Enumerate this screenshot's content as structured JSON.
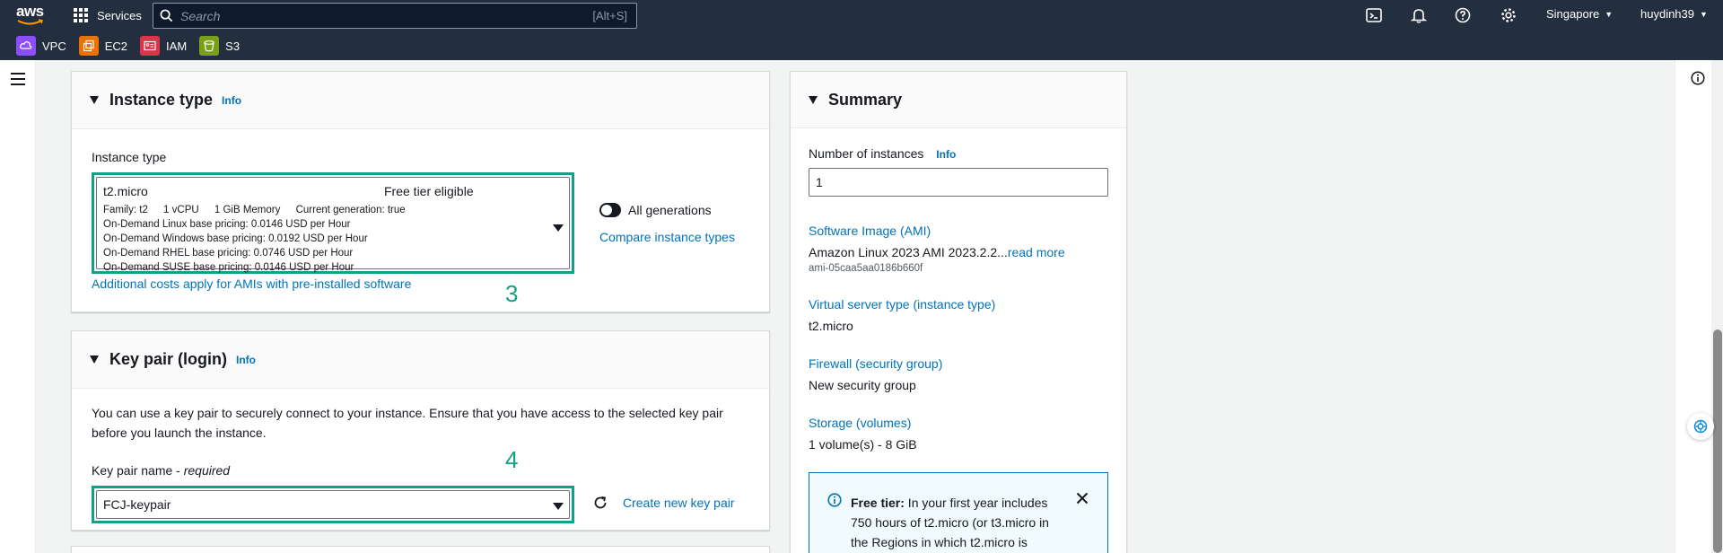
{
  "nav": {
    "logo_text": "aws",
    "services_label": "Services",
    "search_placeholder": "Search",
    "search_shortcut": "[Alt+S]",
    "region": "Singapore",
    "user": "huydinh39",
    "favorites": [
      {
        "label": "VPC",
        "color": "#8c4fff"
      },
      {
        "label": "EC2",
        "color": "#ed7100"
      },
      {
        "label": "IAM",
        "color": "#dd344c"
      },
      {
        "label": "S3",
        "color": "#7aa116"
      }
    ]
  },
  "instance_type_panel": {
    "title": "Instance type",
    "info": "Info",
    "field_label": "Instance type",
    "selected": {
      "name": "t2.micro",
      "badge": "Free tier eligible",
      "family": "Family: t2",
      "vcpu": "1 vCPU",
      "memory": "1 GiB Memory",
      "generation": "Current generation: true",
      "pricing": [
        "On-Demand Linux base pricing: 0.0146 USD per Hour",
        "On-Demand Windows base pricing: 0.0192 USD per Hour",
        "On-Demand RHEL base pricing: 0.0746 USD per Hour",
        "On-Demand SUSE base pricing: 0.0146 USD per Hour"
      ]
    },
    "toggle_label": "All generations",
    "compare_link": "Compare instance types",
    "additional_costs_link": "Additional costs apply for AMIs with pre-installed software",
    "annotation": "3"
  },
  "key_pair_panel": {
    "title": "Key pair (login)",
    "info": "Info",
    "description": "You can use a key pair to securely connect to your instance. Ensure that you have access to the selected key pair before you launch the instance.",
    "field_label": "Key pair name - ",
    "field_required": "required",
    "selected": "FCJ-keypair",
    "create_link": "Create new key pair",
    "annotation": "4"
  },
  "summary": {
    "title": "Summary",
    "instances_label": "Number of instances",
    "info": "Info",
    "instances_value": "1",
    "ami_link": "Software Image (AMI)",
    "ami_value": "Amazon Linux 2023 AMI 2023.2.2...",
    "ami_read_more": "read more",
    "ami_id": "ami-05caa5aa0186b660f",
    "type_link": "Virtual server type (instance type)",
    "type_value": "t2.micro",
    "firewall_link": "Firewall (security group)",
    "firewall_value": "New security group",
    "storage_link": "Storage (volumes)",
    "storage_value": "1 volume(s) - 8 GiB",
    "free_tier_bold": "Free tier:",
    "free_tier_text": " In your first year includes 750 hours of t2.micro (or t3.micro in the Regions in which t2.micro is"
  }
}
